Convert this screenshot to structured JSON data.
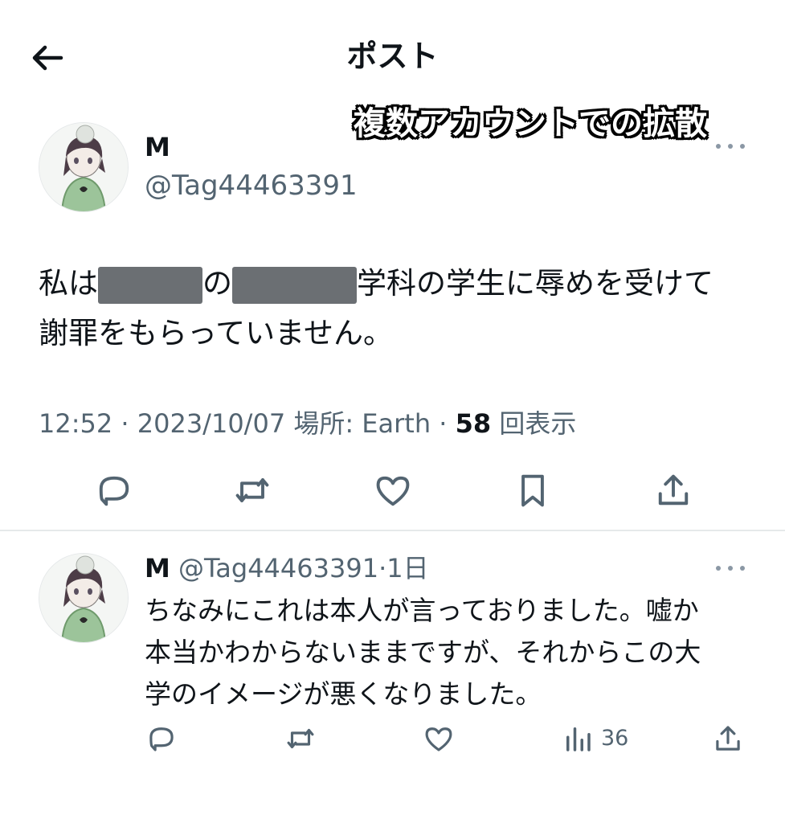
{
  "header": {
    "title": "ポスト"
  },
  "overlay": {
    "caption": "複数アカウントでの拡散"
  },
  "post": {
    "name": "M",
    "handle": "@Tag44463391",
    "text_part1": "私は",
    "text_part2": "の",
    "text_part3": "学科の学生に辱めを受けて",
    "text_line2": "謝罪をもらっていません。",
    "time": "12:52",
    "date": "2023/10/07",
    "location_label": "場所: Earth",
    "views_count": "58",
    "views_label": "回表示"
  },
  "reply": {
    "name": "M",
    "handle": "@Tag44463391",
    "age": "1日",
    "line1": "ちなみにこれは本人が言っておりました。嘘か",
    "line2": "本当かわからないままですが、それからこの大",
    "line3": "学のイメージが悪くなりました。",
    "views": "36"
  },
  "icons": {
    "back": "arrow-left-icon",
    "more": "more-dots-icon",
    "reply": "speech-bubble-icon",
    "retweet": "repost-icon",
    "like": "heart-icon",
    "bookmark": "bookmark-icon",
    "share": "share-upload-icon",
    "views": "bar-chart-icon"
  },
  "colors": {
    "text": "#0f1419",
    "secondary": "#536471",
    "redaction": "#6b6f73"
  }
}
